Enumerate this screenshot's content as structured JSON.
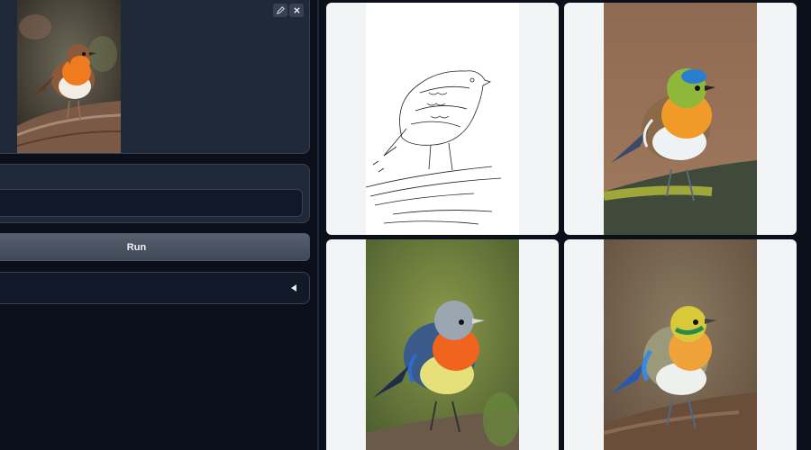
{
  "input_image": {
    "edit_icon": "pencil-icon",
    "clear_icon": "close-icon"
  },
  "prompt": {
    "value": "",
    "placeholder": ""
  },
  "run_button": {
    "label": "Run"
  },
  "advanced_accordion": {
    "collapse_icon": "triangle-left-icon"
  },
  "gallery": {
    "items": [
      {
        "kind": "edge-map"
      },
      {
        "kind": "generated-bird"
      },
      {
        "kind": "generated-bird"
      },
      {
        "kind": "generated-bird"
      }
    ]
  },
  "colors": {
    "background": "#0b0f19",
    "panel": "#1f2937",
    "border": "#374151",
    "thumb_bg": "#f3f4f6"
  }
}
